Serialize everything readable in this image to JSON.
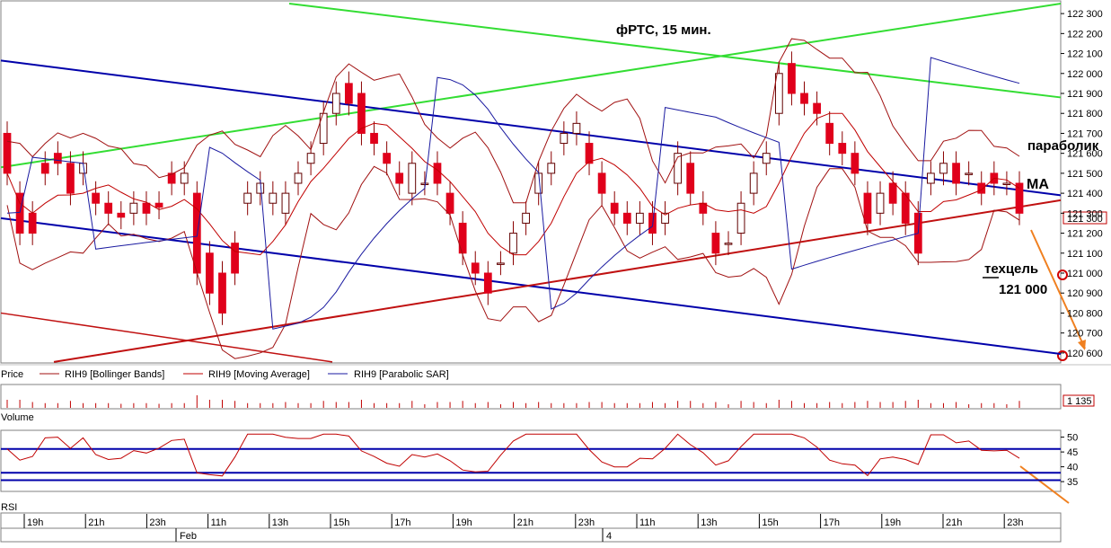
{
  "chart_data": {
    "type": "candlestick",
    "title": "фРТС,  15 мин.",
    "annotations": {
      "parabolic": "параболик",
      "ma": "MA",
      "target_label": "техцель",
      "target_value": "121 000",
      "last_price": "121 300"
    },
    "price_axis": {
      "ylim": [
        120550,
        122350
      ],
      "ticks": [
        "122 300",
        "122 200",
        "122 100",
        "122 000",
        "121 900",
        "121 800",
        "121 700",
        "121 600",
        "121 500",
        "121 400",
        "121 300",
        "121 200",
        "121 100",
        "121 000",
        "120 900",
        "120 800",
        "120 700",
        "120 600"
      ]
    },
    "legend": {
      "price": "Price",
      "bollinger": "RIH9 [Bollinger Bands]",
      "ma": "RIH9 [Moving Average]",
      "psar": "RIH9 [Parabolic SAR]"
    },
    "volume_panel": {
      "label": "Volume",
      "last_value": "1 135"
    },
    "rsi_panel": {
      "label": "RSI",
      "ticks": [
        "50",
        "45",
        "40",
        "35"
      ],
      "ylim": [
        32,
        52
      ],
      "levels": [
        46,
        38,
        35.5
      ]
    },
    "time_axis": {
      "hour_labels": [
        "19h",
        "21h",
        "23h",
        "11h",
        "13h",
        "15h",
        "17h",
        "19h",
        "21h",
        "23h",
        "11h",
        "13h",
        "15h",
        "17h",
        "19h",
        "21h",
        "23h"
      ],
      "date_labels": [
        "Feb",
        "4"
      ]
    },
    "colors": {
      "up": "#ffffff",
      "down": "#e0001b",
      "wick": "#8b0000",
      "bollinger": "#a01010",
      "ma": "#c00000",
      "psar": "#1a1aa0",
      "green_trend": "#33dd33",
      "blue_channel": "#0000aa",
      "red_trend": "#c01010",
      "target_arrow": "#f08020"
    },
    "candles": [
      [
        121700,
        121500
      ],
      [
        121400,
        121200
      ],
      [
        121300,
        121200
      ],
      [
        121550,
        121500
      ],
      [
        121600,
        121550
      ],
      [
        121550,
        121400
      ],
      [
        121500,
        121550
      ],
      [
        121400,
        121350
      ],
      [
        121350,
        121300
      ],
      [
        121300,
        121280
      ],
      [
        121300,
        121350
      ],
      [
        121350,
        121300
      ],
      [
        121350,
        121330
      ],
      [
        121500,
        121450
      ],
      [
        121450,
        121500
      ],
      [
        121400,
        121000
      ],
      [
        121100,
        120900
      ],
      [
        121000,
        120800
      ],
      [
        121150,
        121000
      ],
      [
        121350,
        121400
      ],
      [
        121400,
        121450
      ],
      [
        121350,
        121400
      ],
      [
        121300,
        121400
      ],
      [
        121450,
        121500
      ],
      [
        121550,
        121600
      ],
      [
        121650,
        121800
      ],
      [
        121800,
        121900
      ],
      [
        121950,
        121850
      ],
      [
        121900,
        121700
      ],
      [
        121700,
        121650
      ],
      [
        121600,
        121550
      ],
      [
        121500,
        121450
      ],
      [
        121400,
        121550
      ],
      [
        121450,
        121450
      ],
      [
        121550,
        121450
      ],
      [
        121400,
        121300
      ],
      [
        121250,
        121100
      ],
      [
        121050,
        121000
      ],
      [
        121000,
        120900
      ],
      [
        121050,
        121050
      ],
      [
        121100,
        121200
      ],
      [
        121250,
        121300
      ],
      [
        121400,
        121500
      ],
      [
        121500,
        121550
      ],
      [
        121650,
        121700
      ],
      [
        121700,
        121750
      ],
      [
        121650,
        121550
      ],
      [
        121500,
        121400
      ],
      [
        121350,
        121300
      ],
      [
        121300,
        121250
      ],
      [
        121250,
        121300
      ],
      [
        121300,
        121200
      ],
      [
        121250,
        121300
      ],
      [
        121450,
        121600
      ],
      [
        121550,
        121400
      ],
      [
        121350,
        121300
      ],
      [
        121200,
        121100
      ],
      [
        121150,
        121150
      ],
      [
        121200,
        121350
      ],
      [
        121400,
        121500
      ],
      [
        121550,
        121600
      ],
      [
        121800,
        122000
      ],
      [
        122050,
        121900
      ],
      [
        121900,
        121850
      ],
      [
        121850,
        121800
      ],
      [
        121750,
        121650
      ],
      [
        121650,
        121600
      ],
      [
        121600,
        121500
      ],
      [
        121400,
        121250
      ],
      [
        121300,
        121400
      ],
      [
        121450,
        121350
      ],
      [
        121400,
        121250
      ],
      [
        121300,
        121100
      ],
      [
        121450,
        121500
      ],
      [
        121500,
        121550
      ],
      [
        121550,
        121450
      ],
      [
        121500,
        121500
      ],
      [
        121450,
        121400
      ],
      [
        121500,
        121450
      ],
      [
        121450,
        121450
      ],
      [
        121450,
        121300
      ]
    ]
  }
}
